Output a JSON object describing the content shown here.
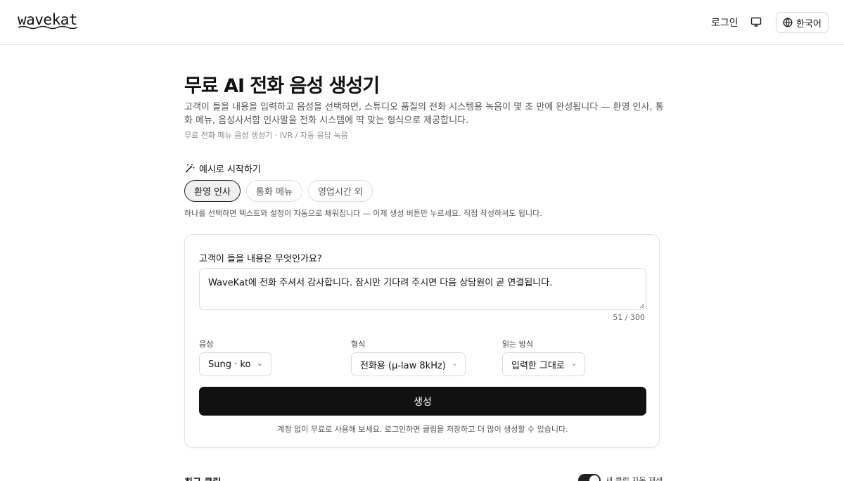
{
  "header": {
    "logo": "wavekat",
    "login": "로그인",
    "language": "한국어"
  },
  "main": {
    "title": "무료 AI 전화 음성 생성기",
    "description": "고객이 들을 내용을 입력하고 음성을 선택하면, 스튜디오 품질의 전화 시스템용 녹음이 몇 초 만에 완성됩니다 — 환영 인사, 통화 메뉴, 음성사서함 인사말을 전화 시스템에 딱 맞는 형식으로 제공합니다.",
    "meta": "무료 전화 메뉴 음성 생성기 · IVR / 자동 응답 녹음"
  },
  "examples": {
    "heading": "예시로 시작하기",
    "chips": [
      {
        "label": "환영 인사",
        "active": true
      },
      {
        "label": "통화 메뉴",
        "active": false
      },
      {
        "label": "영업시간 외",
        "active": false
      }
    ],
    "hint": "하나를 선택하면 텍스트와 설정이 자동으로 채워집니다 — 이제 생성 버튼만 누르세요. 직접 작성하셔도 됩니다."
  },
  "form": {
    "question": "고객이 들을 내용은 무엇인가요?",
    "text": "WaveKat에 전화 주셔서 감사합니다. 잠시만 기다려 주시면 다음 상담원이 곧 연결됩니다.",
    "char_count": "51 / 300",
    "voice": {
      "label": "음성",
      "value": "Sung · ko"
    },
    "format": {
      "label": "형식",
      "value": "전화용 (μ-law 8kHz)"
    },
    "reading": {
      "label": "읽는 방식",
      "value": "입력한 그대로"
    },
    "generate": "생성",
    "note": "계정 없이 무료로 사용해 보세요. 로그인하면 클립을 저장하고 더 많이 생성할 수 있습니다."
  },
  "recent": {
    "title": "최근 클립",
    "autoplay_label": "새 클립 자동 재생",
    "autoplay_on": true
  },
  "colors": {
    "primary": "#111111",
    "border": "#dcdcdc",
    "muted_text": "#555555"
  }
}
